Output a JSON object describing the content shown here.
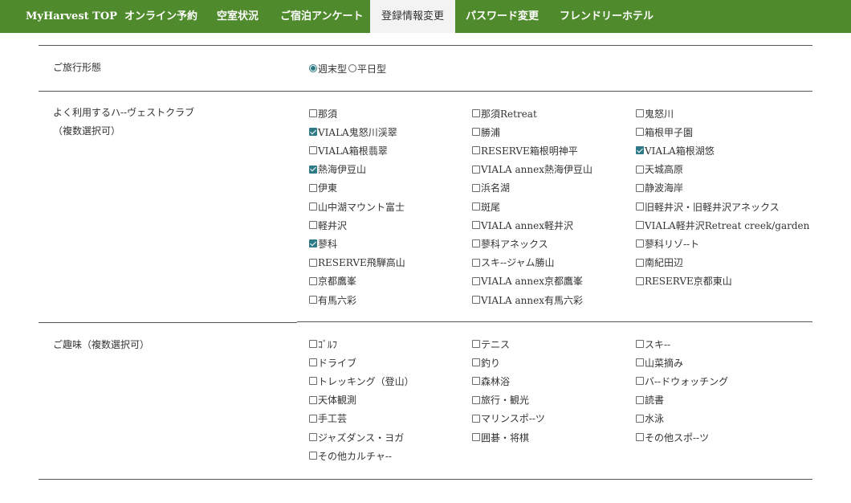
{
  "nav": {
    "items": [
      {
        "label": "MyHarvest TOP",
        "active": false
      },
      {
        "label": "オンライン予約",
        "active": false
      },
      {
        "label": "空室状況",
        "active": false
      },
      {
        "label": "ご宿泊アンケート",
        "active": false
      },
      {
        "label": "登録情報変更",
        "active": true
      },
      {
        "label": "パスワード変更",
        "active": false
      },
      {
        "label": "フレンドリーホテル",
        "active": false
      }
    ]
  },
  "travel_style": {
    "label": "ご旅行形態",
    "options": [
      {
        "label": "週末型",
        "checked": true
      },
      {
        "label": "平日型",
        "checked": false
      }
    ]
  },
  "clubs": {
    "label_line1": "よく利用するハ-‐ヴェストクラブ",
    "label_line2": "（複数選択可）",
    "options": [
      {
        "label": "那須",
        "checked": false
      },
      {
        "label": "那須Retreat",
        "checked": false
      },
      {
        "label": "鬼怒川",
        "checked": false
      },
      {
        "label": "VIALA鬼怒川渓翠",
        "checked": true
      },
      {
        "label": "勝浦",
        "checked": false
      },
      {
        "label": "箱根甲子園",
        "checked": false
      },
      {
        "label": "VIALA箱根翡翠",
        "checked": false
      },
      {
        "label": "RESERVE箱根明神平",
        "checked": false
      },
      {
        "label": "VIALA箱根湖悠",
        "checked": true
      },
      {
        "label": "熱海伊豆山",
        "checked": true
      },
      {
        "label": "VIALA annex熱海伊豆山",
        "checked": false
      },
      {
        "label": "天城高原",
        "checked": false
      },
      {
        "label": "伊東",
        "checked": false
      },
      {
        "label": "浜名湖",
        "checked": false
      },
      {
        "label": "静波海岸",
        "checked": false
      },
      {
        "label": "山中湖マウント富士",
        "checked": false
      },
      {
        "label": "斑尾",
        "checked": false
      },
      {
        "label": "旧軽井沢・旧軽井沢アネックス",
        "checked": false
      },
      {
        "label": "軽井沢",
        "checked": false
      },
      {
        "label": "VIALA annex軽井沢",
        "checked": false
      },
      {
        "label": "VIALA軽井沢Retreat creek/garden",
        "checked": false
      },
      {
        "label": "蓼科",
        "checked": true
      },
      {
        "label": "蓼科アネックス",
        "checked": false
      },
      {
        "label": "蓼科リゾ-‐ト",
        "checked": false
      },
      {
        "label": "RESERVE飛騨高山",
        "checked": false
      },
      {
        "label": "スキ-‐ジャム勝山",
        "checked": false
      },
      {
        "label": "南紀田辺",
        "checked": false
      },
      {
        "label": "京都鷹峯",
        "checked": false
      },
      {
        "label": "VIALA annex京都鷹峯",
        "checked": false
      },
      {
        "label": "RESERVE京都東山",
        "checked": false
      },
      {
        "label": "有馬六彩",
        "checked": false
      },
      {
        "label": "VIALA annex有馬六彩",
        "checked": false
      }
    ]
  },
  "hobbies": {
    "label": "ご趣味（複数選択可）",
    "options": [
      {
        "label": "ｺﾞﾙﾌ",
        "checked": false
      },
      {
        "label": "テニス",
        "checked": false
      },
      {
        "label": "スキ-‐",
        "checked": false
      },
      {
        "label": "ドライブ",
        "checked": false
      },
      {
        "label": "釣り",
        "checked": false
      },
      {
        "label": "山菜摘み",
        "checked": false
      },
      {
        "label": "トレッキング（登山）",
        "checked": false
      },
      {
        "label": "森林浴",
        "checked": false
      },
      {
        "label": "バ-‐ドウォッチング",
        "checked": false
      },
      {
        "label": "天体観測",
        "checked": false
      },
      {
        "label": "旅行・観光",
        "checked": false
      },
      {
        "label": "読書",
        "checked": false
      },
      {
        "label": "手工芸",
        "checked": false
      },
      {
        "label": "マリンスポ-‐ツ",
        "checked": false
      },
      {
        "label": "水泳",
        "checked": false
      },
      {
        "label": "ジャズダンス・ヨガ",
        "checked": false
      },
      {
        "label": "囲碁・将棋",
        "checked": false
      },
      {
        "label": "その他スポ-‐ツ",
        "checked": false
      },
      {
        "label": "その他カルチャ-‐",
        "checked": false
      }
    ]
  },
  "colors": {
    "nav_bg": "#4f8a2c",
    "nav_active_bg": "#f3f3f3",
    "check_accent": "#2e7a86"
  }
}
